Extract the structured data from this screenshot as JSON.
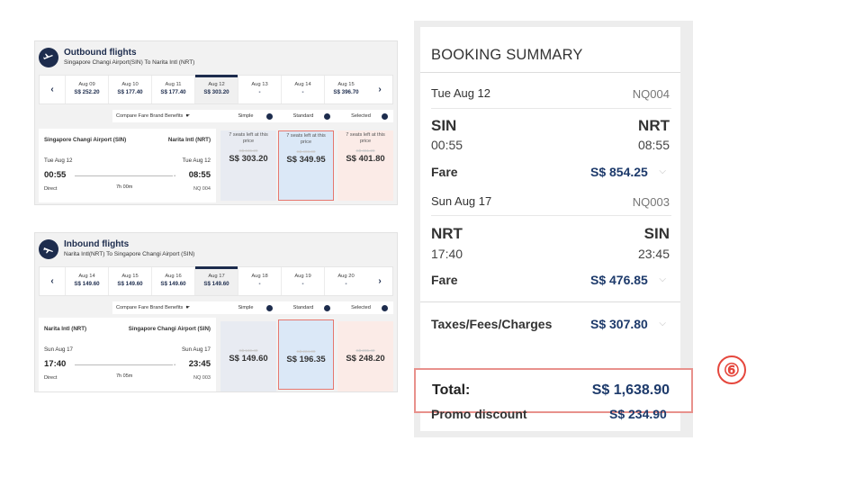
{
  "outbound": {
    "title": "Outbound flights",
    "route": "Singapore Changi Airport(SIN) To Narita Intl (NRT)",
    "dates": [
      {
        "date": "Aug 09",
        "price": "S$ 252.20"
      },
      {
        "date": "Aug 10",
        "price": "S$ 177.40"
      },
      {
        "date": "Aug 11",
        "price": "S$ 177.40"
      },
      {
        "date": "Aug 12",
        "price": "S$ 303.20",
        "active": true
      },
      {
        "date": "Aug 13",
        "price": "-"
      },
      {
        "date": "Aug 14",
        "price": "-"
      },
      {
        "date": "Aug 15",
        "price": "S$ 396.70"
      }
    ],
    "compare_label": "Compare Fare Brand Benefits",
    "brands": [
      "Simple",
      "Standard",
      "Selected"
    ],
    "from": "Singapore Changi Airport (SIN)",
    "to": "Narita Intl (NRT)",
    "dep_date": "Tue Aug 12",
    "arr_date": "Tue Aug 12",
    "dep_time": "00:55",
    "arr_time": "08:55",
    "stops": "Direct",
    "duration": "7h 00m",
    "flight_no": "NQ 004",
    "fares": [
      {
        "seats": "7 seats left at this price",
        "old": "S$ 345.20",
        "price": "S$ 303.20"
      },
      {
        "seats": "7 seats left at this price",
        "old": "S$ 400.00",
        "price": "S$ 349.95"
      },
      {
        "seats": "7 seats left at this price",
        "old": "S$ 461.20",
        "price": "S$ 401.80"
      }
    ]
  },
  "inbound": {
    "title": "Inbound flights",
    "route": "Narita Intl(NRT) To Singapore Changi Airport (SIN)",
    "dates": [
      {
        "date": "Aug 14",
        "price": "S$ 149.60"
      },
      {
        "date": "Aug 15",
        "price": "S$ 149.60"
      },
      {
        "date": "Aug 16",
        "price": "S$ 149.60"
      },
      {
        "date": "Aug 17",
        "price": "S$ 149.60",
        "active": true
      },
      {
        "date": "Aug 18",
        "price": "-"
      },
      {
        "date": "Aug 19",
        "price": "-"
      },
      {
        "date": "Aug 20",
        "price": "-"
      }
    ],
    "compare_label": "Compare Fare Brand Benefits",
    "brands": [
      "Simple",
      "Standard",
      "Selected"
    ],
    "from": "Narita Intl (NRT)",
    "to": "Singapore Changi Airport (SIN)",
    "dep_date": "Sun Aug 17",
    "arr_date": "Sun Aug 17",
    "dep_time": "17:40",
    "arr_time": "23:45",
    "stops": "Direct",
    "duration": "7h 05m",
    "flight_no": "NQ 003",
    "fares": [
      {
        "seats": "",
        "old": "S$ 169.40",
        "price": "S$ 149.60"
      },
      {
        "seats": "",
        "old": "S$ 224.00",
        "price": "S$ 196.35"
      },
      {
        "seats": "",
        "old": "S$ 285.40",
        "price": "S$ 248.20"
      }
    ]
  },
  "summary": {
    "title": "BOOKING SUMMARY",
    "leg1": {
      "date": "Tue Aug 12",
      "flight": "NQ004",
      "from": "SIN",
      "to": "NRT",
      "dep": "00:55",
      "arr": "08:55",
      "fare_label": "Fare",
      "fare": "S$ 854.25"
    },
    "leg2": {
      "date": "Sun Aug 17",
      "flight": "NQ003",
      "from": "NRT",
      "to": "SIN",
      "dep": "17:40",
      "arr": "23:45",
      "fare_label": "Fare",
      "fare": "S$ 476.85"
    },
    "taxes_label": "Taxes/Fees/Charges",
    "taxes": "S$ 307.80",
    "total_label": "Total:",
    "total": "S$ 1,638.90",
    "promo_label": "Promo discount",
    "promo": "S$ 234.90"
  },
  "step_badge": "⑥",
  "colors": {
    "brand": "#1d2c4d",
    "amount": "#1d3a6b",
    "highlight": "#e8918c",
    "badge": "#e5473d"
  }
}
